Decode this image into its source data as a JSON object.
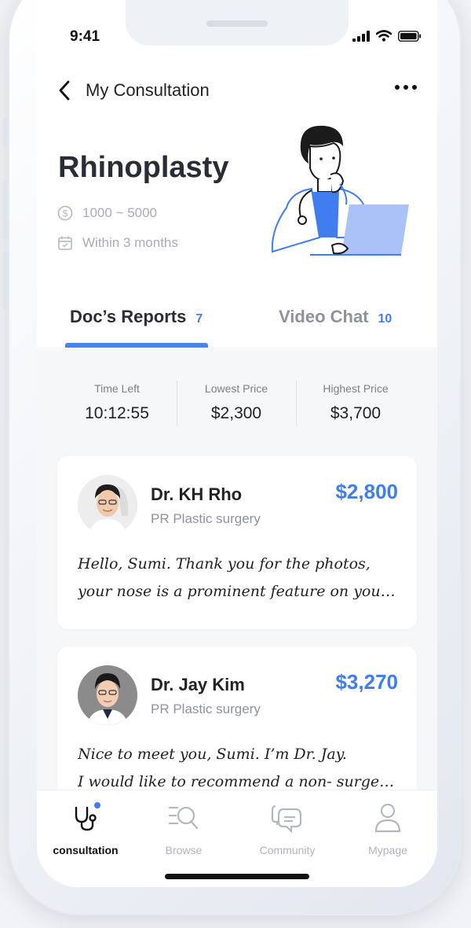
{
  "status": {
    "time": "9:41"
  },
  "header": {
    "title": "My Consultation"
  },
  "procedure": {
    "name": "Rhinoplasty",
    "budget": "1000 ~ 5000",
    "timeframe": "Within 3 months"
  },
  "tabs": [
    {
      "label": "Doc’s Reports",
      "count": "7"
    },
    {
      "label": "Video Chat",
      "count": "10"
    }
  ],
  "stats": [
    {
      "label": "Time Left",
      "value": "10:12:55"
    },
    {
      "label": "Lowest Price",
      "value": "$2,300"
    },
    {
      "label": "Highest Price",
      "value": "$3,700"
    }
  ],
  "reports": [
    {
      "doctor": "Dr. KH Rho",
      "department": "PR Plastic surgery",
      "price": "$2,800",
      "message_line1": "Hello, Sumi. Thank you for the photos,",
      "message_line2": "your nose is a prominent feature on your…"
    },
    {
      "doctor": "Dr. Jay Kim",
      "department": "PR Plastic surgery",
      "price": "$3,270",
      "message_line1": "Nice to meet you, Sumi. I’m Dr. Jay.",
      "message_line2": "I would like to recommend a non- surge…"
    }
  ],
  "nav": [
    {
      "label": "consultation",
      "icon": "stethoscope-icon",
      "active": true
    },
    {
      "label": "Browse",
      "icon": "browse-search-icon"
    },
    {
      "label": "Community",
      "icon": "chat-bubbles-icon"
    },
    {
      "label": "Mypage",
      "icon": "user-icon"
    }
  ],
  "colors": {
    "accent": "#3f7df0",
    "text": "#2a2d36",
    "muted": "#a7acb5"
  }
}
